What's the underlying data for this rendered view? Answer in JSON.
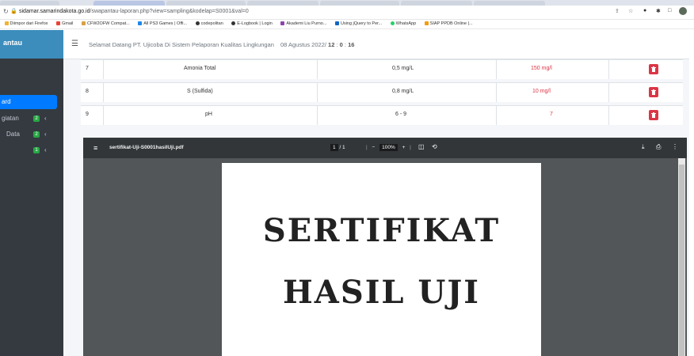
{
  "browser": {
    "address": {
      "host": "sidamar.samarindakota.go.id",
      "path": "/swapantau-laporan.php?view=sampling&kodelap=S0001&val=0"
    },
    "bookmarks": [
      {
        "label": "Diimpor dari Firefox",
        "color": "#f2b233"
      },
      {
        "label": "Gmail",
        "color": "#ea4335"
      },
      {
        "label": "CFW2OFW Compat...",
        "color": "#d8a046"
      },
      {
        "label": "All PS3 Games | Offi...",
        "color": "#1e88e5"
      },
      {
        "label": "codepolitan",
        "color": "#333333"
      },
      {
        "label": "E-Logbook | Login",
        "color": "#333333"
      },
      {
        "label": "Akademi Liu Purno...",
        "color": "#8e44ad"
      },
      {
        "label": "Using jQuery to Per...",
        "color": "#1565c0"
      },
      {
        "label": "WhatsApp",
        "color": "#25d366"
      },
      {
        "label": "SIAP PPDB Online |...",
        "color": "#f39c12"
      }
    ]
  },
  "sidebar": {
    "brand": "antau",
    "items": [
      {
        "label": "ard",
        "active": true
      },
      {
        "label": "giatan",
        "badge": "2"
      },
      {
        "label": "Data",
        "badge": "2"
      },
      {
        "label": "",
        "badge": "1"
      }
    ]
  },
  "header": {
    "welcome_prefix": "Selamat Datang PT. Ujicoba Di Sistem Pelaporan Kualitas Lingkungan",
    "date": "08 Agustus 2022/",
    "time_h": "12",
    "time_m": "0",
    "time_s": "16"
  },
  "table": {
    "rows": [
      {
        "no": "7",
        "param": "Amonia Total",
        "result": "0,5 mg/L",
        "limit": "150 mg/l"
      },
      {
        "no": "8",
        "param": "S (Sulfida)",
        "result": "0,8 mg/L",
        "limit": "10 mg/l"
      },
      {
        "no": "9",
        "param": "pH",
        "result": "6 - 9",
        "limit": "7"
      }
    ]
  },
  "pdf": {
    "filename": "sertifikat-Uji-S0001hasilUji.pdf",
    "page_current": "1",
    "page_total": "/ 1",
    "zoom": "100%",
    "title_line1": "SERTIFIKAT",
    "title_line2": "HASIL UJI"
  },
  "colors": {
    "sidebar_bg": "#343a40",
    "brand_bg": "#3c8dbc",
    "active": "#007bff",
    "danger": "#dc3545",
    "pdf_toolbar": "#323639"
  }
}
